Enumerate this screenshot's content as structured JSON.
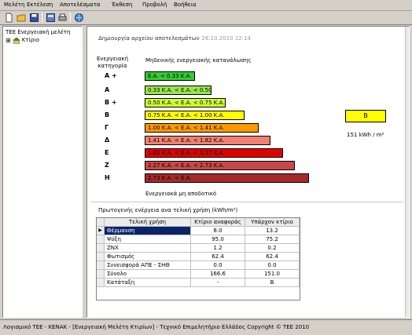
{
  "menu": [
    "Μελέτη",
    "Εκτέλεση",
    "Αποτελέσματα",
    "Έκθεση",
    "Προβολή",
    "Βοήθεια"
  ],
  "tree": {
    "root_label": "ΤΕΕ  Ενεργειακή μελέτη",
    "child_label": "Κτίριο",
    "expander": "⊞"
  },
  "report": {
    "generated_label": "Δημιουργία αρχείου αποτελεσμάτων",
    "generated_date": "26.10.2010 12:14",
    "category_header": "Ενεργειακή κατηγορία",
    "zero_header": "Μηδενικής ενεργειακής κατανάλωσης",
    "inefficient_label": "Ενεργειακά μη αποδοτικό",
    "classes": [
      {
        "letter": "Α +",
        "range": "Ε.Α. < 0.33 Κ.Α.",
        "color": "#33cc33",
        "fraction": 0.193
      },
      {
        "letter": "Α",
        "range": "0.33 Κ.Α. < Ε.Α. < 0.50 Κ.Α.",
        "color": "#99e64d",
        "fraction": 0.257
      },
      {
        "letter": "Β +",
        "range": "0.50 Κ.Α. < Ε.Α. < 0.75 Κ.Α.",
        "color": "#ccff33",
        "fraction": 0.312
      },
      {
        "letter": "Β",
        "range": "0.75 Κ.Α. < Ε.Α. < 1.00 Κ.Α.",
        "color": "#ffff00",
        "fraction": 0.385
      },
      {
        "letter": "Γ",
        "range": "1.00 Κ.Α. < Ε.Α. < 1.41 Κ.Α.",
        "color": "#ff9900",
        "fraction": 0.44
      },
      {
        "letter": "Δ",
        "range": "1.41 Κ.Α. < Ε.Α. < 1.82 Κ.Α.",
        "color": "#f08070",
        "fraction": 0.486
      },
      {
        "letter": "Ε",
        "range": "1.82 Κ.Α. < Ε.Α. < 2.27 Κ.Α.",
        "color": "#e00000",
        "fraction": 0.532
      },
      {
        "letter": "Ζ",
        "range": "2.27 Κ.Α. < Ε.Α. < 2.73 Κ.Α.",
        "color": "#c84848",
        "fraction": 0.578
      },
      {
        "letter": "Η",
        "range": "2.73 Κ.Α. < Ε.Α.",
        "color": "#a52a2a",
        "fraction": 0.633
      }
    ],
    "building_class": "Β",
    "building_value": "151 kWh / m²"
  },
  "table": {
    "caption": "Πρωτογενής ενέργεια ανα τελική χρήση (kWh/m²)",
    "headers": [
      "Τελική χρήση",
      "Κτίριο αναφοράς",
      "Υπάρχον κτίριο"
    ],
    "indicator": "▶",
    "rows": [
      [
        "Θέρμανση",
        "8.0",
        "13.2"
      ],
      [
        "Ψύξη",
        "95.0",
        "75.2"
      ],
      [
        "ΖΝΧ",
        "1.2",
        "0.2"
      ],
      [
        "Φωτισμός",
        "62.4",
        "62.4"
      ],
      [
        "Συνεισφορά ΑΠΕ - ΣΗΘ",
        "0.0",
        "0.0"
      ],
      [
        "Σύνολο",
        "166.6",
        "151.0"
      ],
      [
        "Κατάταξη",
        "-",
        "Β"
      ]
    ]
  },
  "status": "Λογισμικό ΤΕΕ - ΚΕΝΑΚ  -  [Ενεργειακή Μελέτη Κτιρίων]  -  Τεχνικό Επιμελητήριο Ελλάδος  Copyright © ΤΕΕ 2010",
  "colors": {
    "selection": "#0a246a",
    "rating_box": "#ffff00"
  }
}
